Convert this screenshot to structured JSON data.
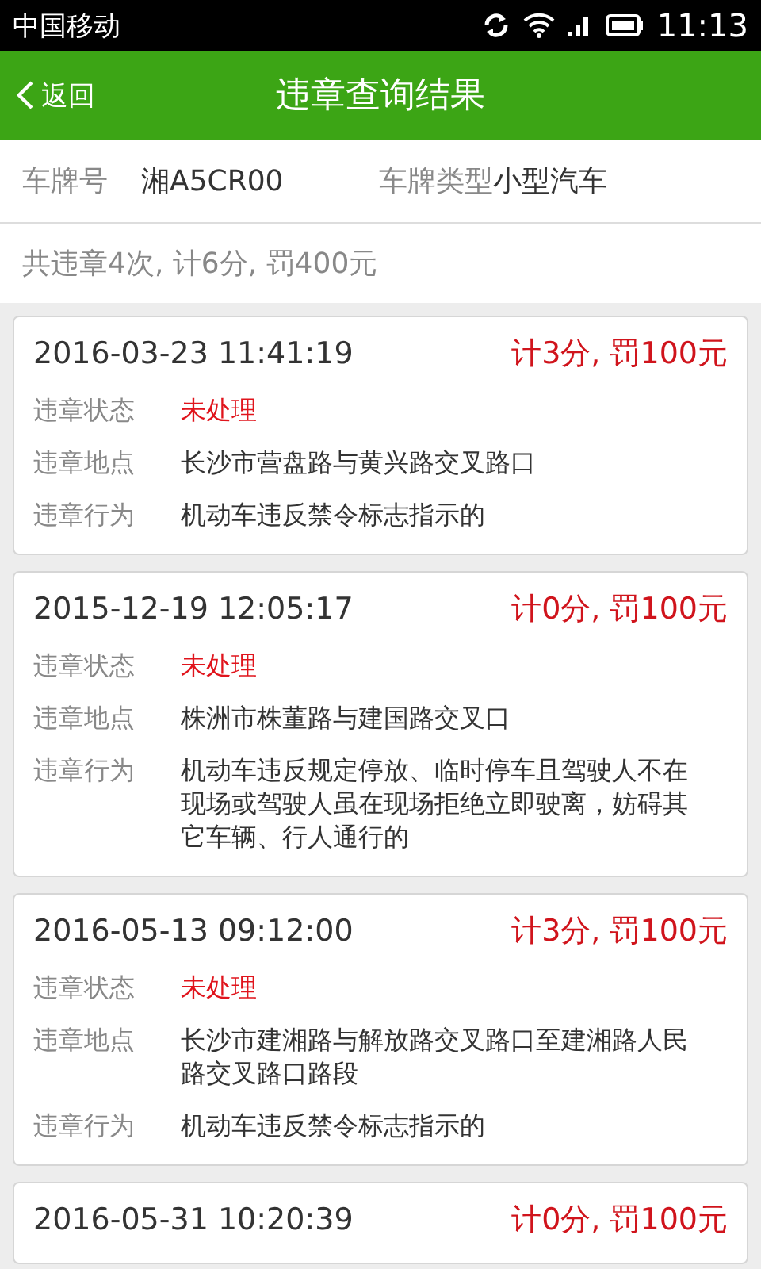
{
  "status_bar": {
    "carrier": "中国移动",
    "time": "11:13"
  },
  "header": {
    "back": "返回",
    "title": "违章查询结果"
  },
  "vehicle": {
    "plate_label": "车牌号",
    "plate": "湘A5CR00",
    "type_label": "车牌类型",
    "type": "小型汽车"
  },
  "summary": "共违章4次, 计6分, 罚400元",
  "records": [
    {
      "datetime": "2016-03-23 11:41:19",
      "penalty": "计3分, 罚100元",
      "status_label": "违章状态",
      "status": "未处理",
      "processed": false,
      "location_label": "违章地点",
      "location": "长沙市营盘路与黄兴路交叉路口",
      "behavior_label": "违章行为",
      "behavior": "机动车违反禁令标志指示的"
    },
    {
      "datetime": "2015-12-19 12:05:17",
      "penalty": "计0分, 罚100元",
      "status_label": "违章状态",
      "status": "未处理",
      "processed": false,
      "location_label": "违章地点",
      "location": "株洲市株董路与建国路交叉口",
      "behavior_label": "违章行为",
      "behavior": "机动车违反规定停放、临时停车且驾驶人不在现场或驾驶人虽在现场拒绝立即驶离，妨碍其它车辆、行人通行的"
    },
    {
      "datetime": "2016-05-13 09:12:00",
      "penalty": "计3分, 罚100元",
      "status_label": "违章状态",
      "status": "未处理",
      "processed": false,
      "location_label": "违章地点",
      "location": "长沙市建湘路与解放路交叉路口至建湘路人民路交叉路口路段",
      "behavior_label": "违章行为",
      "behavior": "机动车违反禁令标志指示的"
    },
    {
      "datetime": "2016-05-31 10:20:39",
      "penalty": "计0分, 罚100元"
    }
  ]
}
